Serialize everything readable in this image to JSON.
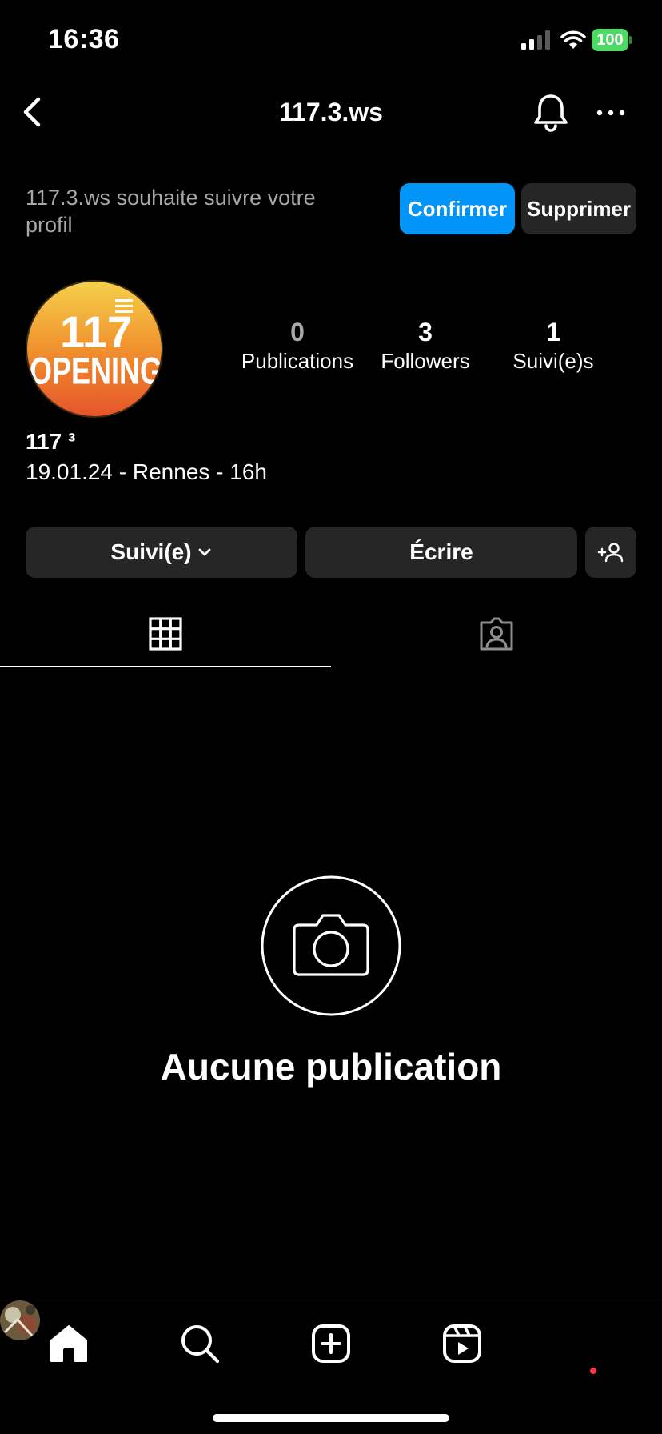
{
  "status_bar": {
    "time": "16:36",
    "battery": "100"
  },
  "header": {
    "title": "117.3.ws"
  },
  "follow_request": {
    "text": "117.3.ws souhaite suivre votre profil",
    "confirm_label": "Confirmer",
    "delete_label": "Supprimer"
  },
  "stats": {
    "posts": {
      "value": "0",
      "label": "Publications"
    },
    "followers": {
      "value": "3",
      "label": "Followers"
    },
    "following": {
      "value": "1",
      "label": "Suivi(e)s"
    }
  },
  "profile": {
    "display_name": "117 ³",
    "bio": "19.01.24 - Rennes - 16h",
    "avatar_text": [
      "117",
      "OPENING"
    ]
  },
  "actions": {
    "following_label": "Suivi(e)",
    "write_label": "Écrire"
  },
  "empty_state": {
    "title": "Aucune publication"
  },
  "colors": {
    "accent": "#0095f6",
    "button_bg": "#262626",
    "secondary_text": "#a8a8a8",
    "battery": "#4cd964"
  }
}
